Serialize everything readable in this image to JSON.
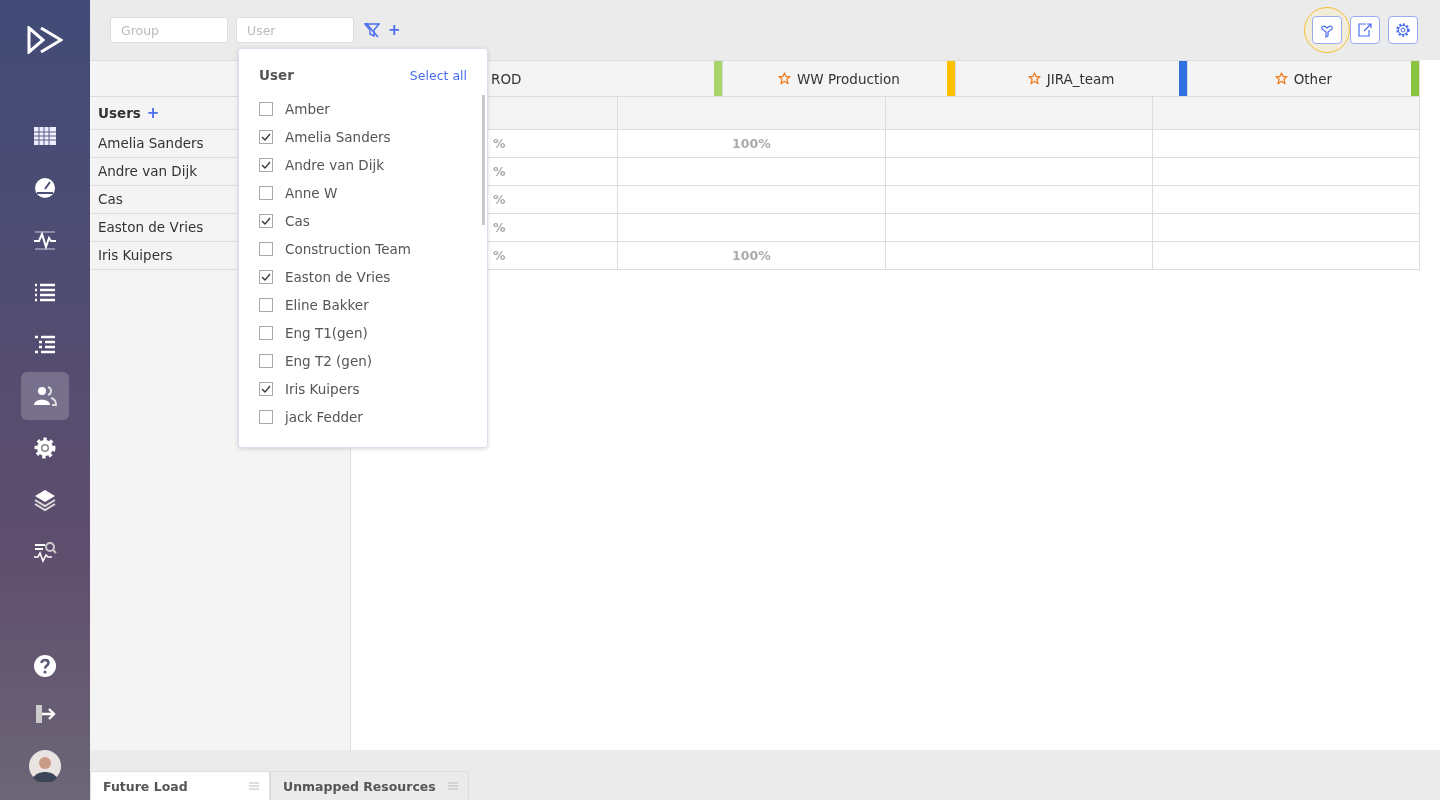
{
  "sidebar": {
    "items": [
      {
        "selected": false
      },
      {
        "selected": false
      },
      {
        "selected": false
      },
      {
        "selected": false
      },
      {
        "selected": false
      },
      {
        "selected": true
      },
      {
        "selected": false
      },
      {
        "selected": false
      },
      {
        "selected": false
      }
    ]
  },
  "filters": {
    "group": {
      "placeholder": "Group"
    },
    "user": {
      "placeholder": "User"
    },
    "add": "+"
  },
  "toolbar": [
    {
      "highlighted": true
    },
    {
      "highlighted": false
    },
    {
      "highlighted": false
    }
  ],
  "users_panel": {
    "title": "Users",
    "add": "+",
    "rows": [
      "Amelia Sanders",
      "Andre van Dijk",
      "Cas",
      "Easton de Vries",
      "Iris Kuipers"
    ]
  },
  "table": {
    "columns": [
      {
        "label": "ROD",
        "color": "#a9d46a"
      },
      {
        "label": "WW Production",
        "color": "#ffc000"
      },
      {
        "label": "JIRA_team",
        "color": "#2f6fdf"
      },
      {
        "label": "Other",
        "color": "#8ac43f"
      }
    ],
    "rows": [
      [
        "%",
        "100%",
        "",
        ""
      ],
      [
        "%",
        "",
        "",
        ""
      ],
      [
        "%",
        "",
        "",
        ""
      ],
      [
        "%",
        "",
        "",
        ""
      ],
      [
        "%",
        "100%",
        "",
        ""
      ]
    ]
  },
  "dropdown": {
    "title": "User",
    "select_all": "Select all",
    "items": [
      {
        "label": "Amber",
        "checked": false
      },
      {
        "label": "Amelia Sanders",
        "checked": true
      },
      {
        "label": "Andre van Dijk",
        "checked": true
      },
      {
        "label": "Anne W",
        "checked": false
      },
      {
        "label": "Cas",
        "checked": true
      },
      {
        "label": "Construction Team",
        "checked": false
      },
      {
        "label": "Easton de Vries",
        "checked": true
      },
      {
        "label": "Eline Bakker",
        "checked": false
      },
      {
        "label": "Eng T1(gen)",
        "checked": false
      },
      {
        "label": "Eng T2 (gen)",
        "checked": false
      },
      {
        "label": "Iris Kuipers",
        "checked": true
      },
      {
        "label": "jack Fedder",
        "checked": false
      }
    ]
  },
  "bottom_tabs": [
    {
      "label": "Future Load",
      "selected": true
    },
    {
      "label": "Unmapped Resources",
      "selected": false
    }
  ]
}
